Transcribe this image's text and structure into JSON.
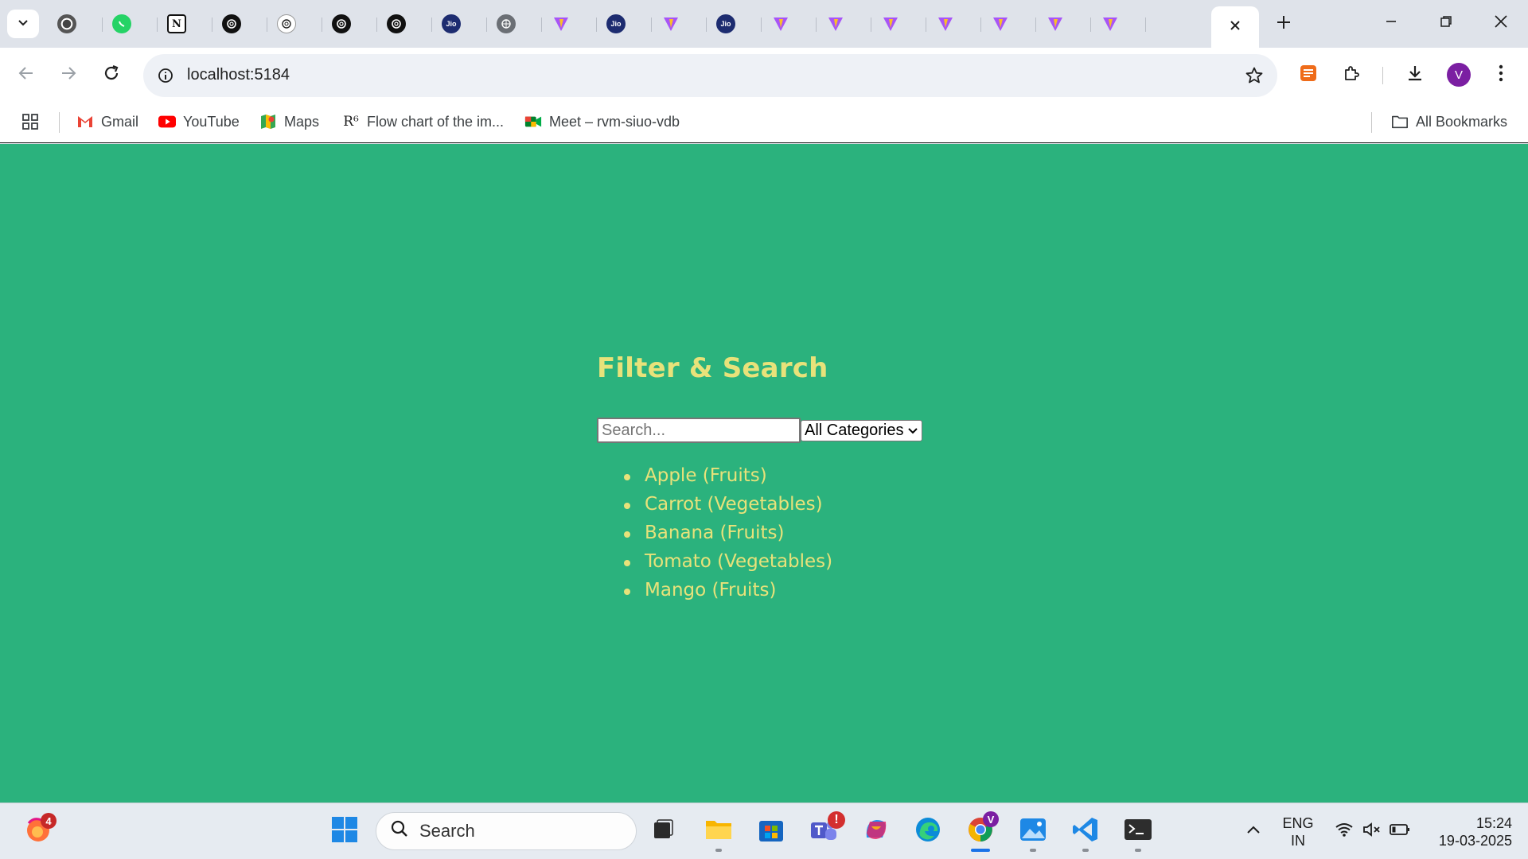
{
  "browser": {
    "tabs": [
      {
        "icon": "chrome-icon"
      },
      {
        "icon": "whatsapp-icon"
      },
      {
        "icon": "notion-icon",
        "glyph": "N"
      },
      {
        "icon": "openai-icon"
      },
      {
        "icon": "openai-outline-icon"
      },
      {
        "icon": "openai-icon"
      },
      {
        "icon": "openai-icon"
      },
      {
        "icon": "jio-icon",
        "glyph": "Jio"
      },
      {
        "icon": "globe-icon"
      },
      {
        "icon": "vite-icon"
      },
      {
        "icon": "jio-icon",
        "glyph": "Jio"
      },
      {
        "icon": "vite-icon"
      },
      {
        "icon": "jio-icon",
        "glyph": "Jio"
      },
      {
        "icon": "vite-icon"
      },
      {
        "icon": "vite-icon"
      },
      {
        "icon": "vite-icon"
      },
      {
        "icon": "vite-icon"
      },
      {
        "icon": "vite-icon"
      },
      {
        "icon": "vite-icon"
      },
      {
        "icon": "vite-icon"
      },
      {
        "icon": "vite-icon"
      }
    ],
    "address": {
      "url": "localhost:5184"
    },
    "profile_initial": "V",
    "bookmarks": [
      {
        "label": "Gmail",
        "icon": "gmail-icon"
      },
      {
        "label": "YouTube",
        "icon": "youtube-icon"
      },
      {
        "label": "Maps",
        "icon": "maps-icon"
      },
      {
        "label": "Flow chart of the im...",
        "icon": "r6-icon",
        "glyph": "R⁶"
      },
      {
        "label": "Meet – rvm-siuo-vdb",
        "icon": "meet-icon"
      }
    ],
    "all_bookmarks_label": "All Bookmarks"
  },
  "page": {
    "heading": "Filter & Search",
    "search_placeholder": "Search...",
    "category_select": {
      "selected": "All Categories"
    },
    "items": [
      "Apple (Fruits)",
      "Carrot (Vegetables)",
      "Banana (Fruits)",
      "Tomato (Vegetables)",
      "Mango (Fruits)"
    ]
  },
  "colors": {
    "page_background": "#2bb27d",
    "accent_text": "#e8e27a"
  },
  "taskbar": {
    "search_label": "Search",
    "firefox_badge": "4",
    "teams_badge": "!",
    "chrome_badge": "V",
    "language": {
      "line1": "ENG",
      "line2": "IN"
    },
    "time": "15:24",
    "date": "19-03-2025"
  }
}
